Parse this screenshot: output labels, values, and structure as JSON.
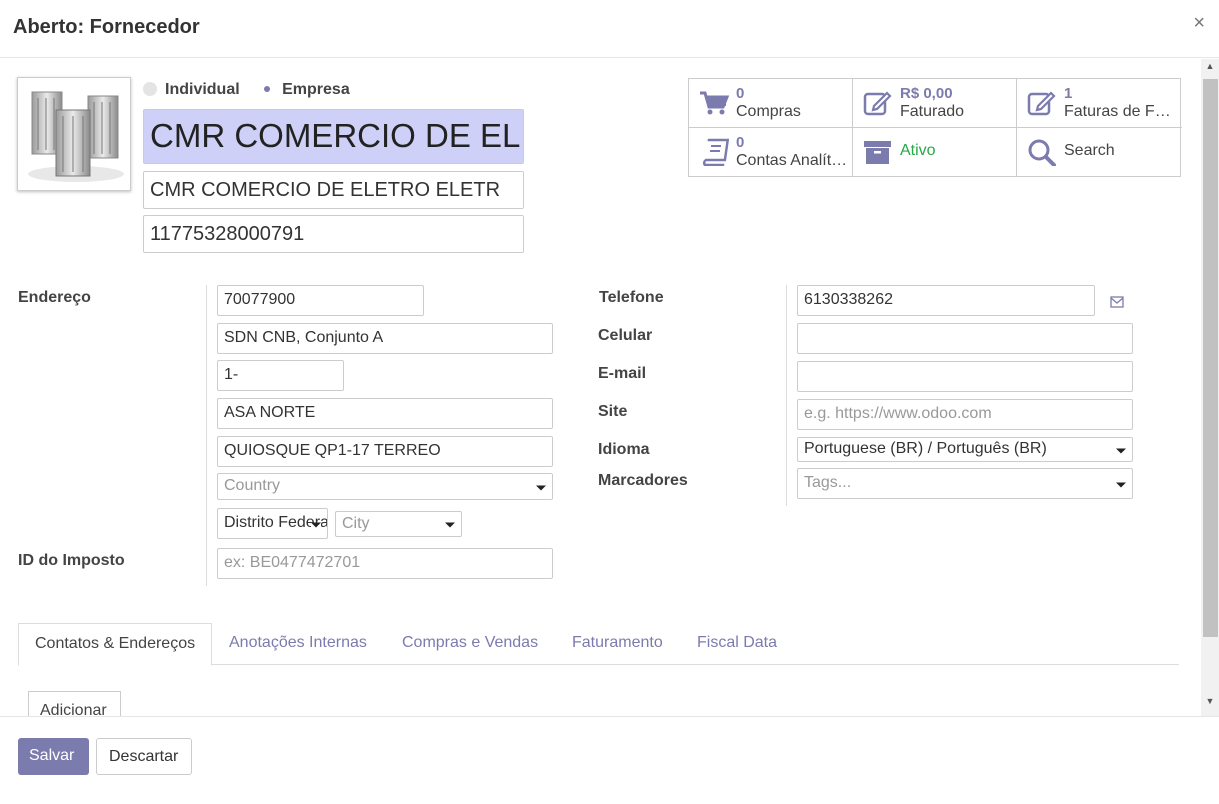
{
  "dialog": {
    "title": "Aberto: Fornecedor",
    "close_label": "×"
  },
  "company_type": {
    "individual_label": "Individual",
    "company_label": "Empresa",
    "selected": "Empresa"
  },
  "header_fields": {
    "name": "CMR COMERCIO DE ELETRO ELETR",
    "trade_name": "CMR COMERCIO DE ELETRO ELETR",
    "cnpj": "11775328000791"
  },
  "smart_buttons": [
    {
      "icon": "cart-icon",
      "number": "0",
      "label": "Compras"
    },
    {
      "icon": "edit-icon",
      "number": "R$ 0,00",
      "label": "Faturado"
    },
    {
      "icon": "edit-icon",
      "number": "1",
      "label": "Faturas de Fornecedor"
    },
    {
      "icon": "book-icon",
      "number": "0",
      "label": "Contas Analíticas"
    },
    {
      "icon": "archive-icon",
      "label": "Ativo",
      "color": "#28a745"
    },
    {
      "icon": "search-icon",
      "label": "Search"
    }
  ],
  "address": {
    "label": "Endereço",
    "zip": "70077900",
    "street": "SDN CNB, Conjunto A",
    "number": "1-",
    "district": "ASA NORTE",
    "street2": "QUIOSQUE QP1-17 TERREO",
    "country_placeholder": "Country",
    "state": "Distrito Federal",
    "city_placeholder": "City"
  },
  "tax": {
    "label": "ID do Imposto",
    "placeholder": "ex: BE0477472701"
  },
  "contact": {
    "phone_label": "Telefone",
    "phone": "6130338262",
    "mobile_label": "Celular",
    "mobile": "",
    "email_label": "E-mail",
    "email": "",
    "site_label": "Site",
    "site_placeholder": "e.g. https://www.odoo.com",
    "language_label": "Idioma",
    "language": "Portuguese (BR) / Português (BR)",
    "tags_label": "Marcadores",
    "tags_placeholder": "Tags..."
  },
  "tabs": [
    {
      "label": "Contatos & Endereços",
      "active": true
    },
    {
      "label": "Anotações Internas",
      "active": false
    },
    {
      "label": "Compras e Vendas",
      "active": false
    },
    {
      "label": "Faturamento",
      "active": false
    },
    {
      "label": "Fiscal Data",
      "active": false
    }
  ],
  "add_button_label": "Adicionar",
  "footer": {
    "save_label": "Salvar",
    "discard_label": "Descartar"
  },
  "colors": {
    "primary": "#7c7bad",
    "name_bg": "#cfd0f7",
    "active_green": "#28a745"
  }
}
